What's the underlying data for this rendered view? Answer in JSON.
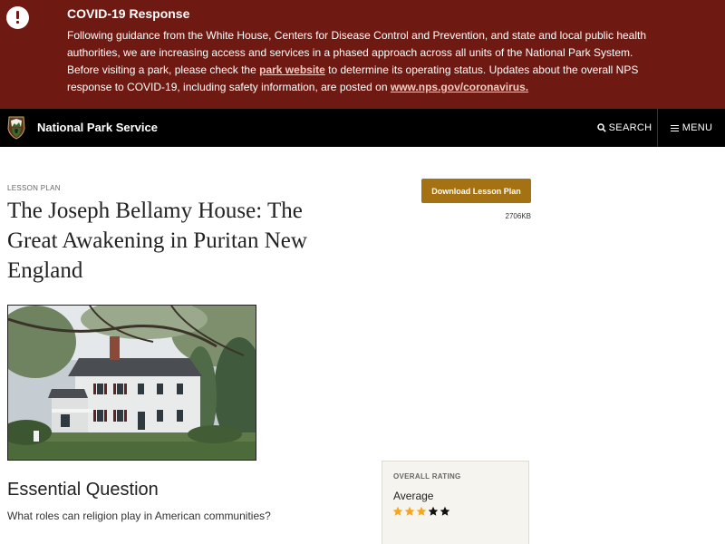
{
  "alert": {
    "title": "COVID-19 Response",
    "text_1": "Following guidance from the White House, Centers for Disease Control and Prevention, and state and local public health authorities, we are increasing access and services in a phased approach across all units of the National Park System. Before visiting a park, please check the ",
    "link_1": "park website",
    "text_2": " to determine its operating status. Updates about the overall NPS response to COVID-19, including safety information, are posted on ",
    "link_2": "www.nps.gov/coronavirus.",
    "icon": "exclamation-icon"
  },
  "header": {
    "site_name": "National Park Service",
    "search_label": "SEARCH",
    "menu_label": "MENU",
    "logo_icon": "arrowhead-logo"
  },
  "lesson": {
    "eyebrow": "LESSON PLAN",
    "title": "The Joseph Bellamy House: The Great Awakening in Puritan New England",
    "download_label": "Download Lesson Plan",
    "file_size": "2706KB"
  },
  "essential": {
    "heading": "Essential Question",
    "question": "What roles can religion play in American communities?"
  },
  "rating": {
    "label": "OVERALL RATING",
    "text": "Average",
    "value": 3,
    "max": 5
  },
  "colors": {
    "alert_bg": "#6e1a12",
    "accent_gold": "#a47212",
    "star_filled": "#f5a623",
    "star_empty": "#111111"
  }
}
